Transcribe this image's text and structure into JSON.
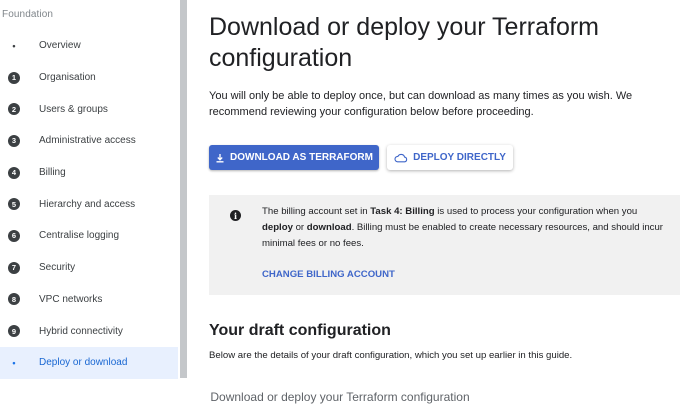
{
  "sidebar": {
    "heading": "Foundation",
    "items": [
      {
        "marker": "•",
        "label": "Overview"
      },
      {
        "marker": "1",
        "label": "Organisation"
      },
      {
        "marker": "2",
        "label": "Users & groups"
      },
      {
        "marker": "3",
        "label": "Administrative access"
      },
      {
        "marker": "4",
        "label": "Billing"
      },
      {
        "marker": "5",
        "label": "Hierarchy and access"
      },
      {
        "marker": "6",
        "label": "Centralise logging"
      },
      {
        "marker": "7",
        "label": "Security"
      },
      {
        "marker": "8",
        "label": "VPC networks"
      },
      {
        "marker": "9",
        "label": "Hybrid connectivity"
      },
      {
        "marker": "•",
        "label": "Deploy or download",
        "active": true
      }
    ]
  },
  "main": {
    "title": "Download or deploy your Terraform configuration",
    "intro": "You will only be able to deploy once, but can download as many times as you wish. We recommend reviewing your configuration below before proceeding.",
    "download_button": "DOWNLOAD AS TERRAFORM",
    "deploy_button": "DEPLOY DIRECTLY",
    "info": {
      "icon": "info-icon",
      "t1": "The billing account set in ",
      "b1": "Task 4: Billing",
      "t2": " is used to process your configuration when you ",
      "b2": "deploy",
      "t3": " or ",
      "b3": "download",
      "t4": ". Billing must be enabled to create necessary resources, and should incur minimal fees or no fees.",
      "link": "CHANGE BILLING ACCOUNT"
    },
    "draft_heading": "Your draft configuration",
    "draft_text": "Below are the details of your draft configuration, which you set up earlier in this guide."
  },
  "caption": "Download or deploy your Terraform configuration",
  "colors": {
    "accent": "#3f66c9",
    "active_bg": "#e8f0fe",
    "info_bg": "#f1f1f1",
    "divider": "#c4c7ca"
  }
}
